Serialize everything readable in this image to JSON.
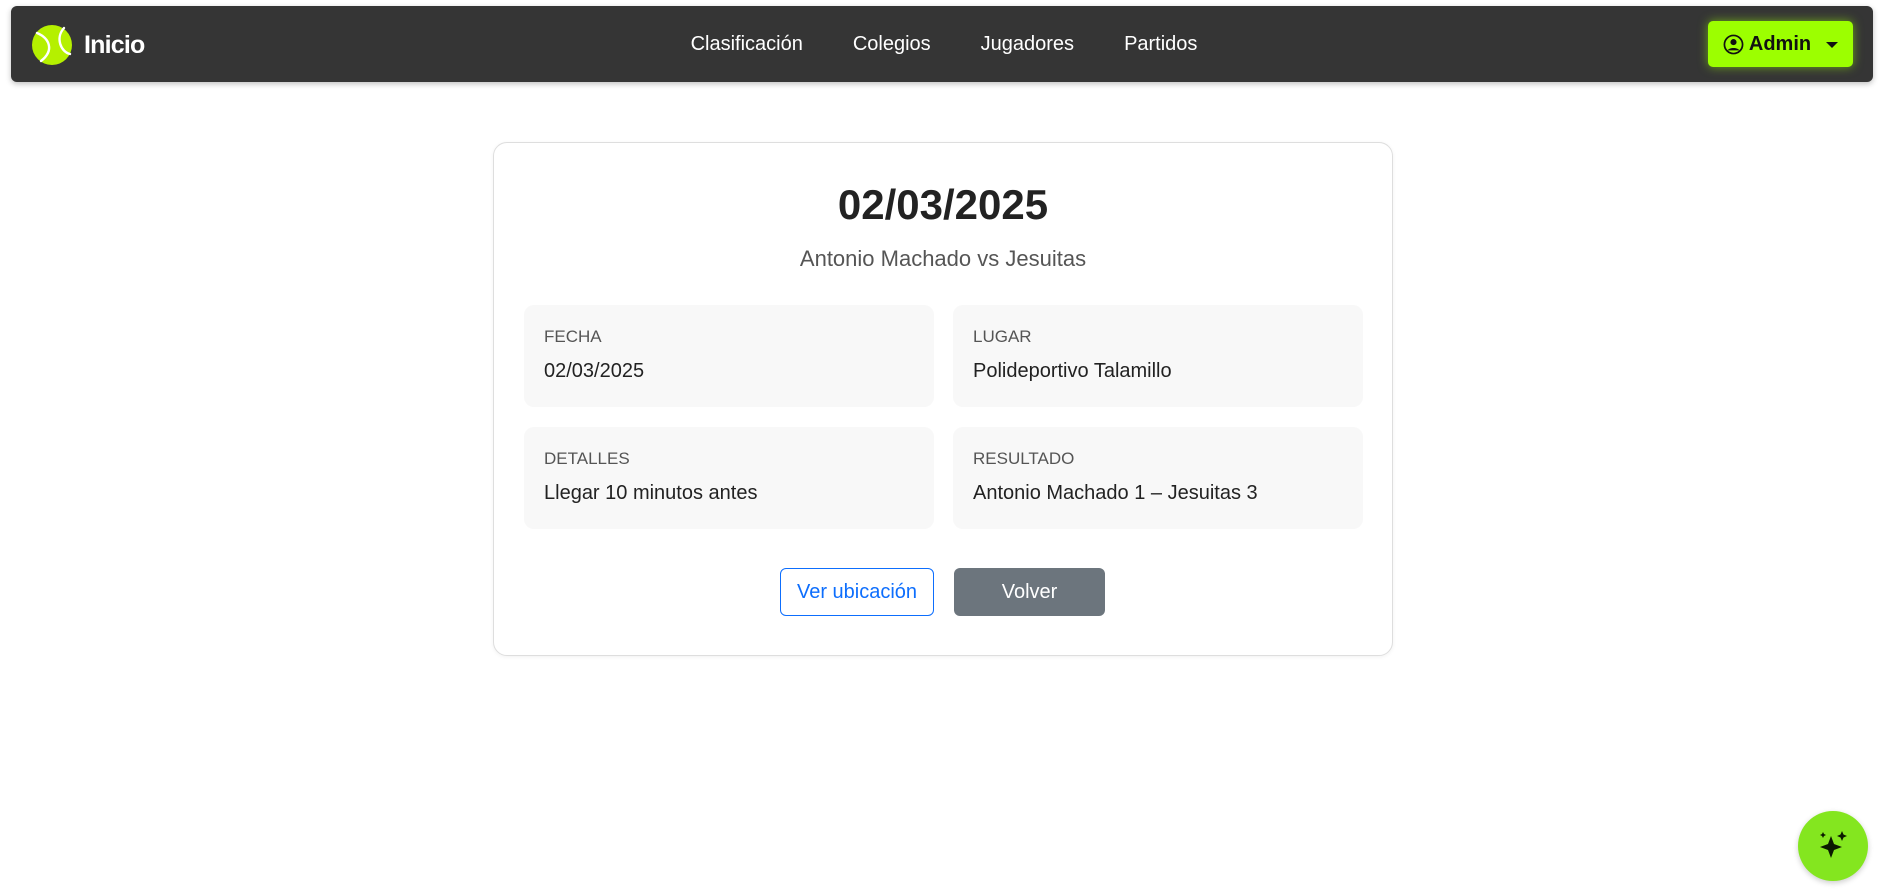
{
  "navbar": {
    "brand_label": "Inicio",
    "brand_icon": "tennis-ball-icon",
    "links": [
      {
        "label": "Clasificación"
      },
      {
        "label": "Colegios"
      },
      {
        "label": "Jugadores"
      },
      {
        "label": "Partidos"
      }
    ],
    "user_menu": {
      "label": "Admin",
      "icon": "user-circle-icon"
    }
  },
  "match": {
    "title": "02/03/2025",
    "subtitle": "Antonio Machado vs Jesuitas",
    "fields": {
      "fecha": {
        "label": "Fecha",
        "value": "02/03/2025"
      },
      "lugar": {
        "label": "Lugar",
        "value": "Polideportivo Talamillo"
      },
      "detalles": {
        "label": "Detalles",
        "value": "Llegar 10 minutos antes"
      },
      "resultado": {
        "label": "Resultado",
        "value": "Antonio Machado 1 – Jesuitas 3"
      }
    },
    "actions": {
      "location_label": "Ver ubicación",
      "back_label": "Volver"
    }
  },
  "fab": {
    "icon": "sparkles-icon"
  },
  "colors": {
    "navbar_bg": "#353535",
    "accent": "#9cff00",
    "fab_bg": "#84e61f",
    "link_blue": "#0d6efd",
    "secondary": "#6c757d"
  }
}
